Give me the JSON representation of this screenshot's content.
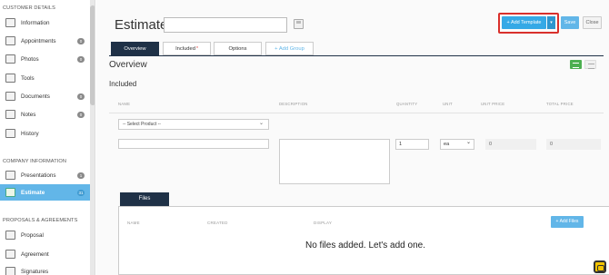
{
  "sidebar": {
    "section_customer": "CUSTOMER DETAILS",
    "section_company": "COMPANY INFORMATION",
    "section_proposals": "PROPOSALS & AGREEMENTS",
    "items": [
      {
        "label": "Information",
        "badge": "",
        "icon": "info-icon"
      },
      {
        "label": "Appointments",
        "badge": "0",
        "icon": "calendar-icon"
      },
      {
        "label": "Photos",
        "badge": "0",
        "icon": "photo-icon"
      },
      {
        "label": "Tools",
        "badge": "",
        "icon": "tools-icon"
      },
      {
        "label": "Documents",
        "badge": "0",
        "icon": "document-icon"
      },
      {
        "label": "Notes",
        "badge": "0",
        "icon": "notes-icon"
      },
      {
        "label": "History",
        "badge": "",
        "icon": "history-icon"
      },
      {
        "label": "Presentations",
        "badge": "1",
        "icon": "presentation-icon"
      },
      {
        "label": "Estimate",
        "badge": "31",
        "icon": "estimate-icon",
        "active": true
      },
      {
        "label": "Proposal",
        "badge": "",
        "icon": "proposal-icon"
      },
      {
        "label": "Agreement",
        "badge": "",
        "icon": "agreement-icon"
      },
      {
        "label": "Signatures",
        "badge": "",
        "icon": "signature-icon"
      }
    ]
  },
  "header": {
    "title": "Estimate:",
    "name_value": "",
    "add_template_label": "+ Add Template",
    "caret_label": "▾",
    "save_label": "Save",
    "close_label": "Close"
  },
  "tabs": [
    {
      "label": "Overview",
      "active": true
    },
    {
      "label": "Included",
      "required": "*"
    },
    {
      "label": "Options"
    },
    {
      "label": "+ Add Group"
    }
  ],
  "overview": {
    "heading": "Overview",
    "included_heading": "Included",
    "columns": {
      "name": "NAME",
      "description": "DESCRIPTION",
      "quantity": "QUANTITY",
      "unit": "UNIT",
      "unit_price": "UNIT PRICE",
      "total_price": "TOTAL PRICE"
    },
    "select_product": "-- Select Product --",
    "row": {
      "quantity": "1",
      "unit": "ea",
      "unit_price": "0",
      "total_price": "0"
    }
  },
  "files": {
    "tab_label": "Files",
    "columns": {
      "name": "NAME",
      "created": "CREATED",
      "display": "DISPLAY"
    },
    "add_files_label": "+ Add Files",
    "empty_message": "No files added. Let's add one."
  },
  "colors": {
    "accent": "#35a9e6",
    "active_sidebar": "#62b6e8",
    "dark_tab": "#1f3147",
    "highlight": "#d9302b",
    "green": "#4caf50"
  }
}
